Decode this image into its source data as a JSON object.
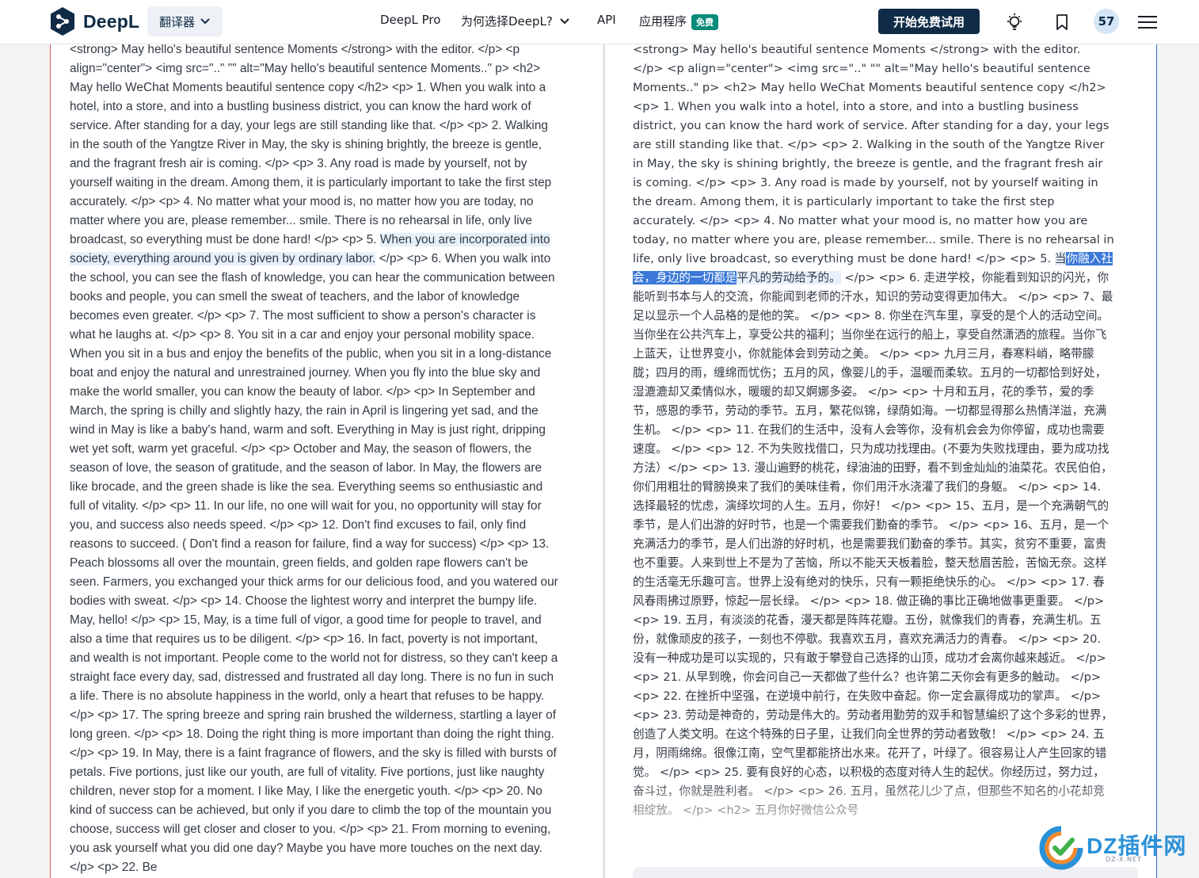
{
  "header": {
    "brand": "DeepL",
    "translator_label": "翻译器",
    "nav": {
      "pro": "DeepL Pro",
      "why": "为何选择DeepL?",
      "api": "API",
      "apps": "应用程序",
      "apps_badge": "免费"
    },
    "cta": "开始免费试用",
    "avatar_count": "57"
  },
  "icons": {
    "lightbulb": "lightbulb-icon",
    "bookmark": "bookmark-icon",
    "menu": "hamburger-menu-icon",
    "chevron": "chevron-down-icon"
  },
  "colors": {
    "brand_navy": "#0f2b46",
    "badge_green": "#0a8a7a",
    "highlight_blue": "#3b78d8",
    "highlight_soft": "#e6f0fb"
  },
  "source": {
    "before": "<strong> May hello's beautiful sentence Moments </strong> with the editor. </p> <p align=\"center\"> <img src=\"..\" \"\" alt=\"May hello's beautiful sentence Moments..\" p> <h2> May hello WeChat Moments beautiful sentence copy </h2> <p> 1. When you walk into a hotel, into a store, and into a bustling business district, you can know the hard work of service. After standing for a day, your legs are still standing like that. </p> <p> 2. Walking in the south of the Yangtze River in May, the sky is shining brightly, the breeze is gentle, and the fragrant fresh air is coming. </p> <p> 3. Any road is made by yourself, not by yourself waiting in the dream. Among them, it is particularly important to take the first step accurately. </p> <p> 4. No matter what your mood is, no matter how you are today, no matter where you are, please remember... smile. There is no rehearsal in life, only live broadcast, so everything must be done hard! </p> <p> 5. ",
    "highlight": "When you are incorporated into society, everything around you is given by ordinary labor.",
    "after": " </p> <p> 6. When you walk into the school, you can see the flash of knowledge, you can hear the communication between books and people, you can smell the sweat of teachers, and the labor of knowledge becomes even greater. </p> <p> 7. The most sufficient to show a person's character is what he laughs at. </p> <p> 8. You sit in a car and enjoy your personal mobility space. When you sit in a bus and enjoy the benefits of the public, when you sit in a long-distance boat and enjoy the natural and unrestrained journey. When you fly into the blue sky and make the world smaller, you can know the beauty of labor. </p> <p> In September and March, the spring is chilly and slightly hazy, the rain in April is lingering yet sad, and the wind in May is like a baby's hand, warm and soft. Everything in May is just right, dripping wet yet soft, warm yet graceful. </p> <p> October and May, the season of flowers, the season of love, the season of gratitude, and the season of labor. In May, the flowers are like brocade, and the green shade is like the sea. Everything seems so enthusiastic and full of vitality. </p> <p> 11. In our life, no one will wait for you, no opportunity will stay for you, and success also needs speed. </p> <p> 12. Don't find excuses to fail, only find reasons to succeed. ( Don't find a reason for failure, find a way for success) </p> <p> 13. Peach blossoms all over the mountain, green fields, and golden rape flowers can't be seen. Farmers, you exchanged your thick arms for our delicious food, and you watered our bodies with sweat. </p> <p> 14. Choose the lightest worry and interpret the bumpy life. May, hello! </p> <p> 15, May, is a time full of vigor, a good time for people to travel, and also a time that requires us to be diligent. </p> <p> 16. In fact, poverty is not important, and wealth is not important. People come to the world not for distress, so they can't keep a straight face every day, sad, distressed and frustrated all day long. There is no fun in such a life. There is no absolute happiness in the world, only a heart that refuses to be happy. </p> <p> 17. The spring breeze and spring rain brushed the wilderness, startling a layer of long green. </p> <p> 18. Doing the right thing is more important than doing the right thing. </p> <p> 19. In May, there is a faint fragrance of flowers, and the sky is filled with bursts of petals. Five portions, just like our youth, are full of vitality. Five portions, just like naughty children, never stop for a moment. I like May, I like the energetic youth. </p> <p> 20. No kind of success can be achieved, but only if you dare to climb the top of the mountain you choose, success will get closer and closer to you. </p> <p> 21. From morning to evening, you ask yourself what you did one day? Maybe you have more touches on the next day. </p> <p> 22. Be"
  },
  "target": {
    "before": "<strong> May hello's beautiful sentence Moments </strong> with the editor. </p> <p align=\"center\"> <img src=\"..\" \"\" alt=\"May hello's beautiful sentence Moments..\" p> <h2> May hello WeChat Moments beautiful sentence copy </h2> <p> 1. When you walk into a hotel, into a store, and into a bustling business district, you can know the hard work of service. After standing for a day, your legs are still standing like that. </p> <p> 2. Walking in the south of the Yangtze River in May, the sky is shining brightly, the breeze is gentle, and the fragrant fresh air is coming. </p> <p> 3. Any road is made by yourself, not by yourself waiting in the dream. Among them, it is particularly important to take the first step accurately. </p> <p> 4. No matter what your mood is, no matter how you are today, no matter where you are, please remember... smile. There is no rehearsal in life, only live broadcast, so everything must be done hard! </p> <p> 5. ",
    "soft": "当",
    "strong": "你融入社会，身边的一切都是",
    "soft2": "平凡的劳动给予的。",
    "after": " </p> <p> 6. 走进学校，你能看到知识的闪光，你能听到书本与人的交流，你能闻到老师的汗水，知识的劳动变得更加伟大。 </p> <p> 7、最足以显示一个人品格的是他的笑。 </p> <p> 8. 你坐在汽车里，享受的是个人的活动空间。当你坐在公共汽车上，享受公共的福利；当你坐在远行的船上，享受自然潇洒的旅程。当你飞上蓝天，让世界变小，你就能体会到劳动之美。 </p> <p> 九月三月，春寒料峭，略带朦胧；四月的雨，缠绵而忧伤；五月的风，像婴儿的手，温暖而柔软。五月的一切都恰到好处，湿漉漉却又柔情似水，暖暖的却又婀娜多姿。 </p> <p> 十月和五月，花的季节，爱的季节，感恩的季节，劳动的季节。五月，繁花似锦，绿荫如海。一切都显得那么热情洋溢，充满生机。 </p> <p> 11. 在我们的生活中，没有人会等你，没有机会会为你停留，成功也需要速度。 </p> <p> 12. 不为失败找借口，只为成功找理由。(不要为失败找理由，要为成功找方法）</p> <p> 13. 漫山遍野的桃花，绿油油的田野，看不到金灿灿的油菜花。农民伯伯，你们用粗壮的臂膀换来了我们的美味佳肴，你们用汗水浇灌了我们的身躯。 </p> <p> 14. 选择最轻的忧虑，演绎坎坷的人生。五月，你好！ </p> <p> 15、五月，是一个充满朝气的季节，是人们出游的好时节，也是一个需要我们勤奋的季节。 </p> <p> 16、五月，是一个充满活力的季节，是人们出游的好时机，也是需要我们勤奋的季节。其实，贫穷不重要，富贵也不重要。人来到世上不是为了苦恼，所以不能天天板着脸，整天愁眉苦脸，苦恼无奈。这样的生活毫无乐趣可言。世界上没有绝对的快乐，只有一颗拒绝快乐的心。 </p> <p> 17. 春风春雨拂过原野，惊起一层长绿。 </p> <p> 18. 做正确的事比正确地做事更重要。 </p> <p> 19. 五月，有淡淡的花香，漫天都是阵阵花瓣。五份，就像我们的青春，充满生机。五份，就像顽皮的孩子，一刻也不停歇。我喜欢五月，喜欢充满活力的青春。 </p> <p> 20. 没有一种成功是可以实现的，只有敢于攀登自己选择的山顶，成功才会离你越来越近。 </p> <p> 21. 从早到晚，你会问自己一天都做了些什么？也许第二天你会有更多的触动。 </p> <p> 22. 在挫折中坚强，在逆境中前行，在失败中奋起。你一定会赢得成功的掌声。 </p> <p> 23. 劳动是神奇的，劳动是伟大的。劳动者用勤劳的双手和智慧编织了这个多彩的世界，创造了人类文明。在这个特殊的日子里，让我们向全世界的劳动者致敬！ </p> <p> 24. 五月，阴雨绵绵。很像江南，空气里都能挤出水来。花开了，叶绿了。很容易让人产生回家的错觉。 </p> <p> 25. 要有良好的心态，以积极的态度对待人生的起伏。你经历过，努力过，奋斗过，你就是胜利者。 </p> <p> 26. 五月，虽然花儿少了点，但那些不知名的小花却竞相绽放。 </p> <h2> 五月你好微信公众号"
  },
  "watermark": {
    "text": "DZ插件网",
    "sub": "DZ-X.NET"
  }
}
